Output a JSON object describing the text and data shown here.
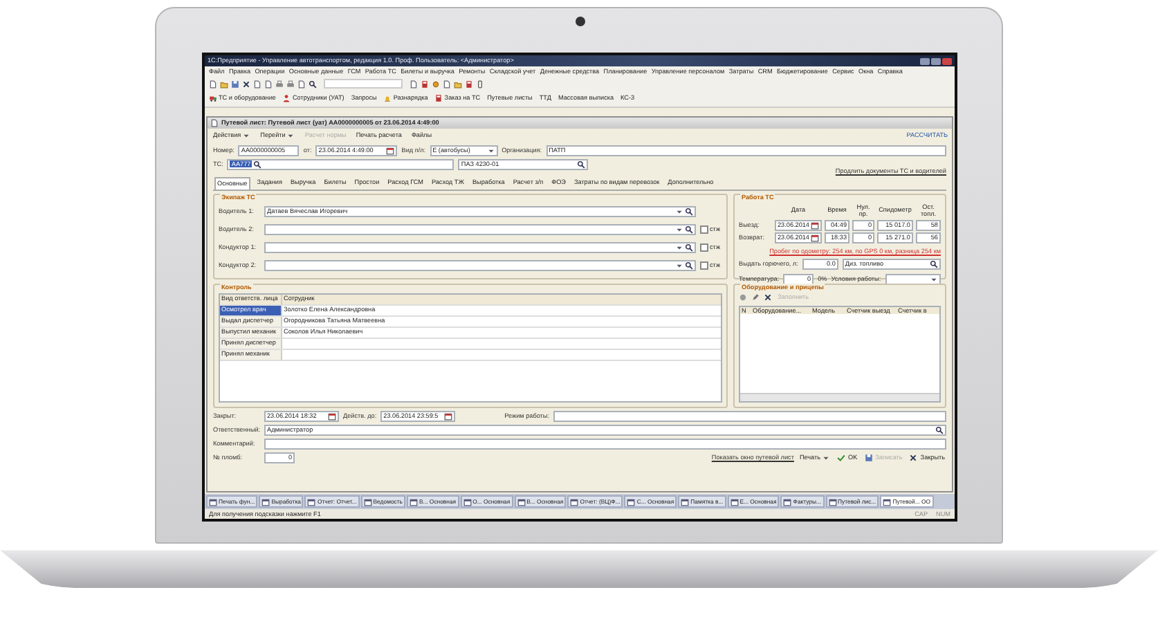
{
  "app": {
    "title": "1С:Предприятие - Управление автотранспортом, редакция 1.0. Проф. Пользователь: <Администратор>",
    "menu": [
      "Файл",
      "Правка",
      "Операции",
      "Основные данные",
      "ГСМ",
      "Работа ТС",
      "Билеты и выручка",
      "Ремонты",
      "Складской учет",
      "Денежные средства",
      "Планирование",
      "Управление персоналом",
      "Затраты",
      "CRM",
      "Бюджетирование",
      "Сервис",
      "Окна",
      "Справка"
    ],
    "quick_panel": [
      "ТС и оборудование",
      "Сотрудники (УАТ)",
      "Запросы",
      "Разнарядка",
      "Заказ на ТС",
      "Путевые листы",
      "ТТД",
      "Массовая выписка",
      "КС-3"
    ]
  },
  "document": {
    "title": "Путевой лист: Путевой лист (уат) АА0000000005 от 23.06.2014 4:49:00",
    "actions": [
      {
        "label": "Действия",
        "disabled": false
      },
      {
        "label": "Перейти",
        "disabled": false
      },
      {
        "label": "Расчет нормы",
        "disabled": true
      },
      {
        "label": "Печать расчета",
        "disabled": false
      },
      {
        "label": "Файлы",
        "disabled": false
      }
    ],
    "calculate_link": "РАССЧИТАТЬ",
    "header_fields": [
      {
        "label": "Номер:",
        "value": "АА0000000005"
      },
      {
        "label": "от:",
        "value": "23.06.2014 4:49:00"
      },
      {
        "label": "Вид п/л:",
        "value": "Е (автобусы)"
      },
      {
        "label": "Организация:",
        "value": "ПАТП"
      }
    ],
    "vehicle": {
      "label": "ТС:",
      "code": "АА777",
      "model": "ПАЗ 4230-01"
    },
    "extend_link": "Продлить документы ТС и водителей",
    "tabs": [
      {
        "label": "Основные",
        "selected": true
      },
      {
        "label": "Задания",
        "selected": false
      },
      {
        "label": "Выручка",
        "selected": false
      },
      {
        "label": "Билеты",
        "selected": false
      },
      {
        "label": "Простои",
        "selected": false
      },
      {
        "label": "Расход ГСМ",
        "selected": false
      },
      {
        "label": "Расход ТЖ",
        "selected": false
      },
      {
        "label": "Выработка",
        "selected": false
      },
      {
        "label": "Расчет з/п",
        "selected": false
      },
      {
        "label": "ФОЭ",
        "selected": false
      },
      {
        "label": "Затраты по видам перевозок",
        "selected": false
      },
      {
        "label": "Дополнительно",
        "selected": false
      }
    ],
    "crew": {
      "title": "Экипаж ТС",
      "rows": [
        {
          "label": "Водитель 1:",
          "value": "Датаев Вячеслав Игоревич"
        },
        {
          "label": "Водитель 2:",
          "checkbox": {
            "label": "стж",
            "checked": false
          }
        },
        {
          "label": "Кондуктор 1:",
          "checkbox": {
            "label": "стж",
            "checked": false
          }
        },
        {
          "label": "Кондуктор 2:",
          "checkbox": {
            "label": "стж",
            "checked": false
          }
        }
      ]
    },
    "vehicle_work": {
      "title": "Работа ТС",
      "columns": [
        "Дата",
        "Время",
        "Нул. пр.",
        "Спидометр",
        "Ост. топл."
      ],
      "rows": [
        {
          "label": "Выезд:",
          "cells": [
            "23.06.2014",
            "04:49",
            "0",
            "15 017.0",
            "58"
          ]
        },
        {
          "label": "Возврат:",
          "cells": [
            "23.06.2014",
            "18:33",
            "0",
            "15 271.0",
            "56"
          ]
        }
      ],
      "mileage_note": "Пробег по одометру: 254 км, по GPS 0 км, разница 254 км",
      "fuel": {
        "label": "Выдать горючего, л:",
        "value": "0.0",
        "fuel_type": "Диз. топливо"
      },
      "temperature": {
        "label": "Температура:",
        "value": "0",
        "unit": "0%"
      },
      "conditions_label": "Условия работы:"
    },
    "control": {
      "title": "Контроль",
      "columns": [
        "Вид ответств. лица",
        "Сотрудник"
      ],
      "rows": [
        {
          "role": "Осмотрел врач",
          "employee": "Золотко Елена Александровна",
          "selected": true
        },
        {
          "role": "Выдал диспетчер",
          "employee": "Огородникова Татьяна Матвеевна",
          "selected": false
        },
        {
          "role": "Выпустил механик",
          "employee": "Соколов Илья Николаевич",
          "selected": false
        },
        {
          "role": "Принял диспетчер",
          "selected": false
        },
        {
          "role": "Принял механик",
          "selected": false
        }
      ]
    },
    "equipment": {
      "title": "Оборудование и прицепы",
      "fill_button": "Заполнить",
      "columns": [
        "N",
        "Оборудование...",
        "Модель",
        "Счетчик выезд",
        "Счетчик в"
      ]
    },
    "footer": {
      "closed": {
        "label": "Закрыт:",
        "value": "23.06.2014 18:32"
      },
      "valid_until": {
        "label": "Действ. до:",
        "value": "23.06.2014 23:59:5"
      },
      "work_mode": {
        "label": "Режим работы:"
      },
      "responsible": {
        "label": "Ответственный:",
        "value": "Администратор"
      },
      "comment": {
        "label": "Комментарий:"
      },
      "seal": {
        "label": "№ пломб:",
        "value": "0"
      },
      "show_link": "Показать окно путевой лист",
      "print_button": "Печать",
      "buttons": [
        {
          "label": "OK",
          "disabled": false
        },
        {
          "label": "Записать",
          "disabled": true
        },
        {
          "label": "Закрыть",
          "disabled": false
        }
      ]
    }
  },
  "taskbar": [
    {
      "label": "Печать фун...",
      "selected": false
    },
    {
      "label": "Выработка",
      "selected": false
    },
    {
      "label": "Отчет: Отчет...",
      "selected": false
    },
    {
      "label": "Ведомость",
      "selected": false
    },
    {
      "label": "В... Основная",
      "selected": false
    },
    {
      "label": "О... Основная",
      "selected": false
    },
    {
      "label": "В... Основная",
      "selected": false
    },
    {
      "label": "Отчет: (ВЦ)Ф...",
      "selected": false
    },
    {
      "label": "С... Основная",
      "selected": false
    },
    {
      "label": "Памятка в...",
      "selected": false
    },
    {
      "label": "Е... Основная",
      "selected": false
    },
    {
      "label": "Фактуры...",
      "selected": false
    },
    {
      "label": "Путевой лис...",
      "selected": false
    },
    {
      "label": "Путевой... ОО",
      "selected": true
    }
  ],
  "status_bar": {
    "hint": "Для получения подсказки нажмите F1",
    "indicators": [
      "CAP",
      "NUM"
    ]
  }
}
